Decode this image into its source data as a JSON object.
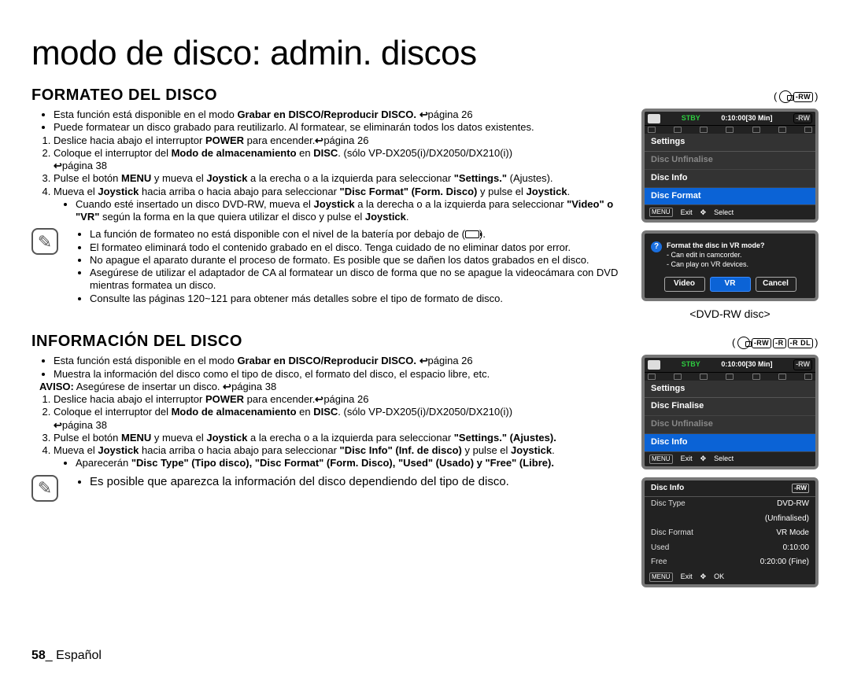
{
  "title": "modo de disco: admin. discos",
  "section1": {
    "heading": "FORMATEO DEL DISCO",
    "badge_rw": "-RW",
    "bullets_intro": [
      {
        "pre": "Esta función está disponible en el modo ",
        "b": "Grabar en DISCO/Reproducir DISCO.",
        "pageref": "página 26"
      },
      {
        "pre": "Puede formatear un disco grabado para reutilizarlo. Al formatear, se eliminarán todos los datos existentes.",
        "b": "",
        "pageref": ""
      }
    ],
    "steps": [
      {
        "t1": "Deslice hacia abajo el interruptor ",
        "b1": "POWER",
        "t2": " para encender.",
        "pageref": "página 26"
      },
      {
        "t1": "Coloque el interruptor del ",
        "b1": "Modo de almacenamiento",
        "t2": " en ",
        "b2": "DISC",
        "t3": ". (sólo VP-DX205(i)/DX2050/DX210(i)) ",
        "pageref": "página 38"
      },
      {
        "t1": "Pulse el botón ",
        "b1": "MENU",
        "t2": " y mueva el ",
        "b2": "Joystick",
        "t3": " a la erecha o a la izquierda para seleccionar ",
        "q": "\"Settings.\"",
        "t4": " (Ajustes)."
      },
      {
        "t1": "Mueva el ",
        "b1": "Joystick",
        "t2": " hacia arriba o hacia abajo para seleccionar ",
        "q": "\"Disc Format\" (Form. Disco)",
        "t3": " y pulse el ",
        "b2": "Joystick",
        "t4": "."
      }
    ],
    "step4_sub": [
      {
        "t1": "Cuando esté insertado un disco DVD-RW, mueva el ",
        "b1": "Joystick",
        "t2": " a la derecha o a la izquierda para seleccionar ",
        "q": "\"Video\" o \"VR\"",
        "t3": " según la forma en la que quiera utilizar el disco y pulse el ",
        "b2": "Joystick",
        "t4": "."
      }
    ],
    "notes": [
      "La función de formateo no está disponible con el nivel de la batería por debajo de (",
      ").",
      "El formateo eliminará todo el contenido grabado en el disco. Tenga cuidado de no eliminar datos por error.",
      "No apague el aparato durante el proceso de formato. Es posible que se dañen los datos grabados en el disco.",
      "Asegúrese de utilizar el adaptador de CA al formatear un disco de forma que no se apague la videocámara con DVD mientras formatea un disco.",
      "Consulte las páginas 120~121 para obtener más detalles sobre el tipo de formato de disco."
    ],
    "screen1": {
      "stby": "STBY",
      "timecode": "0:10:00[30 Min]",
      "menu_head": "Settings",
      "items": [
        "Disc Unfinalise",
        "Disc Info",
        "Disc Format"
      ],
      "sel_index": 2,
      "grey_index": 0,
      "btn_menu": "MENU",
      "btn_exit": "Exit",
      "btn_select": "Select"
    },
    "dialog": {
      "question": "Format the disc in VR mode?",
      "line1": "- Can edit in camcorder.",
      "line2": "- Can play on VR devices.",
      "btns": [
        "Video",
        "VR",
        "Cancel"
      ],
      "sel_index": 1
    },
    "caption": "<DVD-RW disc>"
  },
  "section2": {
    "heading": "INFORMACIÓN DEL DISCO",
    "badges": [
      "-RW",
      "-R",
      "-R DL"
    ],
    "bullets_intro": [
      {
        "pre": "Esta función está disponible en el modo ",
        "b": "Grabar en DISCO/Reproducir DISCO.",
        "pageref": "página 26"
      },
      {
        "pre": "Muestra la información del disco como el tipo de disco, el formato del disco, el espacio libre, etc.",
        "b": "",
        "pageref": ""
      }
    ],
    "aviso_label": "AVISO:",
    "aviso_text": " Asegúrese de insertar un disco. ",
    "aviso_page": "página 38",
    "steps": [
      {
        "t1": "Deslice hacia abajo el interruptor ",
        "b1": "POWER",
        "t2": " para encender.",
        "pageref": "página 26"
      },
      {
        "t1": "Coloque el interruptor del ",
        "b1": "Modo de almacenamiento",
        "t2": " en ",
        "b2": "DISC",
        "t3": ". (sólo VP-DX205(i)/DX2050/DX210(i)) ",
        "pageref": "página 38"
      },
      {
        "t1": "Pulse el botón ",
        "b1": "MENU",
        "t2": " y mueva el ",
        "b2": "Joystick",
        "t3": " a la erecha o a la izquierda para seleccionar ",
        "q": "\"Settings.\" (Ajustes)."
      },
      {
        "t1": "Mueva el ",
        "b1": "Joystick",
        "t2": " hacia arriba o hacia abajo para seleccionar ",
        "q": "\"Disc Info\" (Inf. de disco)",
        "t3": " y pulse el ",
        "b2": "Joystick",
        "t4": "."
      }
    ],
    "step4_sub": [
      {
        "t1": "Aparecerán ",
        "q": "\"Disc Type\" (Tipo disco), \"Disc Format\" (Form. Disco), \"Used\" (Usado) y \"Free\" (Libre)."
      }
    ],
    "note": "Es posible que aparezca la información del disco dependiendo del tipo de disco.",
    "screen2": {
      "stby": "STBY",
      "timecode": "0:10:00[30 Min]",
      "menu_head": "Settings",
      "items": [
        "Disc Finalise",
        "Disc Unfinalise",
        "Disc Info"
      ],
      "sel_index": 2,
      "grey_index": 1,
      "btn_menu": "MENU",
      "btn_exit": "Exit",
      "btn_select": "Select"
    },
    "info": {
      "title": "Disc Info",
      "rw": "-RW",
      "rows": [
        {
          "k": "Disc Type",
          "v": "DVD-RW"
        },
        {
          "k": "",
          "v": "(Unfinalised)"
        },
        {
          "k": "Disc Format",
          "v": "VR Mode"
        },
        {
          "k": "Used",
          "v": "0:10:00"
        },
        {
          "k": "Free",
          "v": "0:20:00 (Fine)"
        }
      ],
      "btn_menu": "MENU",
      "btn_exit": "Exit",
      "btn_ok": "OK"
    }
  },
  "footer": {
    "page": "58",
    "sep": "_ ",
    "lang": "Español"
  }
}
